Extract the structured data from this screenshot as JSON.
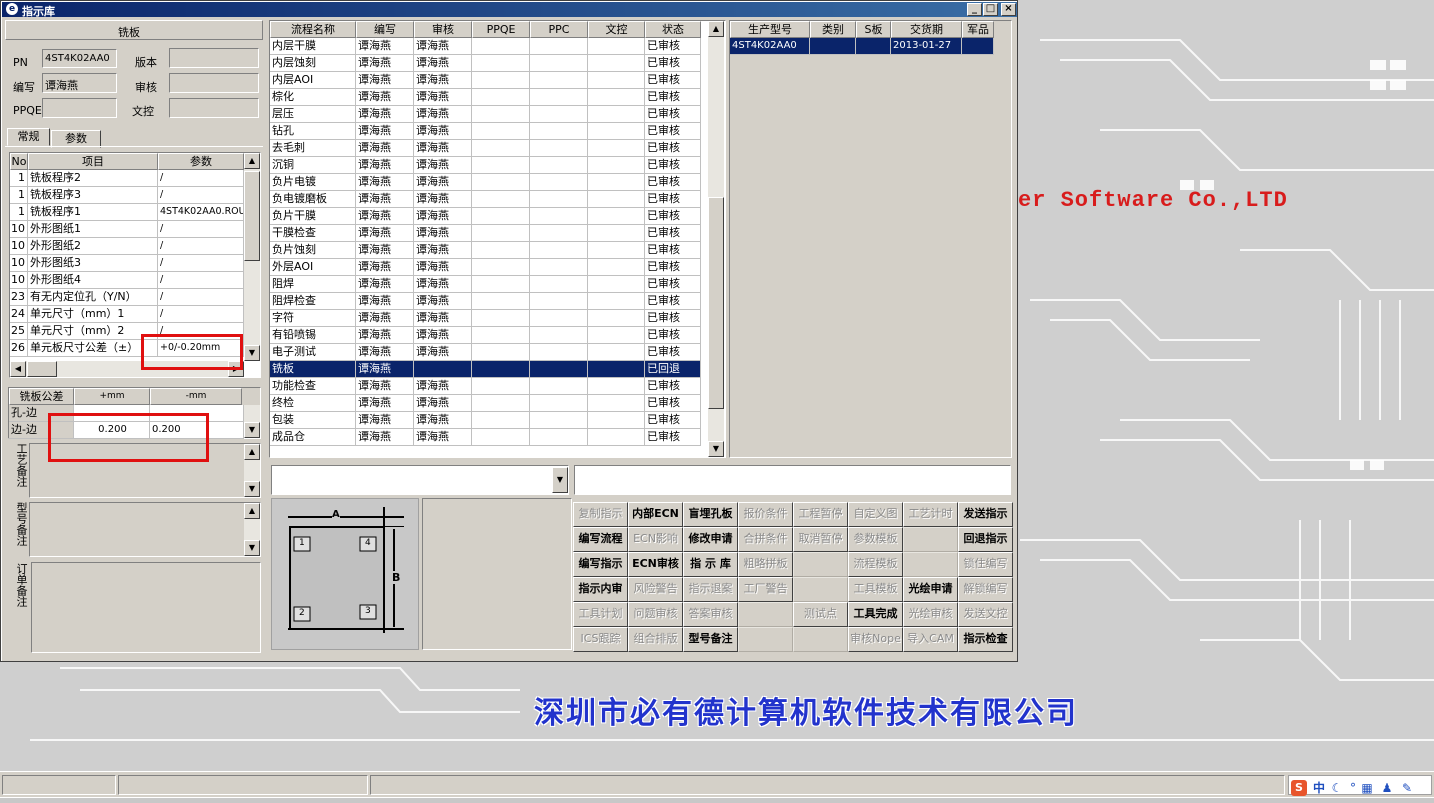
{
  "window": {
    "title": "指示库"
  },
  "left_panel": {
    "section_title": "铣板",
    "fields": {
      "pn_label": "PN",
      "pn_value": "4ST4K02AA0",
      "version_label": "版本",
      "version_value": "",
      "writer_label": "编写",
      "writer_value": "谭海燕",
      "reviewer_label": "审核",
      "reviewer_value": "",
      "ppqe_label": "PPQE",
      "ppqe_value": "",
      "doc_label": "文控",
      "doc_value": ""
    },
    "tabs": [
      "常规",
      "参数"
    ],
    "param_headers": [
      "No",
      "项目",
      "参数"
    ],
    "params": [
      {
        "no": "1",
        "item": "铣板程序2",
        "value": "/"
      },
      {
        "no": "1",
        "item": "铣板程序3",
        "value": "/"
      },
      {
        "no": "1",
        "item": "铣板程序1",
        "value": "4ST4K02AA0.ROU"
      },
      {
        "no": "10",
        "item": "外形图纸1",
        "value": "/"
      },
      {
        "no": "10",
        "item": "外形图纸2",
        "value": "/"
      },
      {
        "no": "10",
        "item": "外形图纸3",
        "value": "/"
      },
      {
        "no": "10",
        "item": "外形图纸4",
        "value": "/"
      },
      {
        "no": "23",
        "item": "有无内定位孔（Y/N）",
        "value": "/"
      },
      {
        "no": "24",
        "item": "单元尺寸（mm）1",
        "value": "/"
      },
      {
        "no": "25",
        "item": "单元尺寸（mm）2",
        "value": "/"
      },
      {
        "no": "26",
        "item": "单元板尺寸公差（±）",
        "value": "+0/-0.20mm"
      }
    ],
    "tolerance_headers": [
      "铣板公差",
      "+mm",
      "-mm"
    ],
    "tolerance_rows": [
      {
        "name": "孔-边",
        "plus": "",
        "minus": ""
      },
      {
        "name": "边-边",
        "plus": "0.200",
        "minus": "0.200"
      }
    ],
    "notes": [
      "工艺备注",
      "型号备注",
      "订单备注"
    ]
  },
  "flow_table": {
    "headers": [
      "流程名称",
      "编写",
      "审核",
      "PPQE",
      "PPC",
      "文控",
      "状态"
    ],
    "rows": [
      {
        "name": "内层干膜",
        "writer": "谭海燕",
        "reviewer": "谭海燕",
        "status": "已审核"
      },
      {
        "name": "内层蚀刻",
        "writer": "谭海燕",
        "reviewer": "谭海燕",
        "status": "已审核"
      },
      {
        "name": "内层AOI",
        "writer": "谭海燕",
        "reviewer": "谭海燕",
        "status": "已审核"
      },
      {
        "name": "棕化",
        "writer": "谭海燕",
        "reviewer": "谭海燕",
        "status": "已审核"
      },
      {
        "name": "层压",
        "writer": "谭海燕",
        "reviewer": "谭海燕",
        "status": "已审核"
      },
      {
        "name": "钻孔",
        "writer": "谭海燕",
        "reviewer": "谭海燕",
        "status": "已审核"
      },
      {
        "name": "去毛刺",
        "writer": "谭海燕",
        "reviewer": "谭海燕",
        "status": "已审核"
      },
      {
        "name": "沉铜",
        "writer": "谭海燕",
        "reviewer": "谭海燕",
        "status": "已审核"
      },
      {
        "name": "负片电镀",
        "writer": "谭海燕",
        "reviewer": "谭海燕",
        "status": "已审核"
      },
      {
        "name": "负电镀磨板",
        "writer": "谭海燕",
        "reviewer": "谭海燕",
        "status": "已审核"
      },
      {
        "name": "负片干膜",
        "writer": "谭海燕",
        "reviewer": "谭海燕",
        "status": "已审核"
      },
      {
        "name": "干膜检查",
        "writer": "谭海燕",
        "reviewer": "谭海燕",
        "status": "已审核"
      },
      {
        "name": "负片蚀刻",
        "writer": "谭海燕",
        "reviewer": "谭海燕",
        "status": "已审核"
      },
      {
        "name": "外层AOI",
        "writer": "谭海燕",
        "reviewer": "谭海燕",
        "status": "已审核"
      },
      {
        "name": "阻焊",
        "writer": "谭海燕",
        "reviewer": "谭海燕",
        "status": "已审核"
      },
      {
        "name": "阻焊检查",
        "writer": "谭海燕",
        "reviewer": "谭海燕",
        "status": "已审核"
      },
      {
        "name": "字符",
        "writer": "谭海燕",
        "reviewer": "谭海燕",
        "status": "已审核"
      },
      {
        "name": "有铅喷锡",
        "writer": "谭海燕",
        "reviewer": "谭海燕",
        "status": "已审核"
      },
      {
        "name": "电子测试",
        "writer": "谭海燕",
        "reviewer": "谭海燕",
        "status": "已审核"
      },
      {
        "name": "铣板",
        "writer": "谭海燕",
        "reviewer": "",
        "status": "已回退"
      },
      {
        "name": "功能检查",
        "writer": "谭海燕",
        "reviewer": "谭海燕",
        "status": "已审核"
      },
      {
        "name": "终检",
        "writer": "谭海燕",
        "reviewer": "谭海燕",
        "status": "已审核"
      },
      {
        "name": "包装",
        "writer": "谭海燕",
        "reviewer": "谭海燕",
        "status": "已审核"
      },
      {
        "name": "成品仓",
        "writer": "谭海燕",
        "reviewer": "谭海燕",
        "status": "已审核"
      }
    ],
    "selected_index": 19
  },
  "product_table": {
    "headers": [
      "生产型号",
      "类别",
      "S板",
      "交货期",
      "军品"
    ],
    "rows": [
      {
        "model": "4ST4K02AA0",
        "type": "",
        "s": "",
        "date": "2013-01-27",
        "mil": ""
      }
    ]
  },
  "diagram": {
    "label_a": "A",
    "label_b": "B",
    "corners": [
      "1",
      "4",
      "2",
      "3"
    ]
  },
  "buttons": [
    {
      "label": "复制指示",
      "state": "dis"
    },
    {
      "label": "内部ECN",
      "state": "en"
    },
    {
      "label": "盲埋孔板",
      "state": "en"
    },
    {
      "label": "报价条件",
      "state": "dis"
    },
    {
      "label": "工程暂停",
      "state": "dis"
    },
    {
      "label": "自定义图",
      "state": "dis"
    },
    {
      "label": "工艺计时",
      "state": "dis"
    },
    {
      "label": "发送指示",
      "state": "en"
    },
    {
      "label": "编写流程",
      "state": "en"
    },
    {
      "label": "ECN影响",
      "state": "dis"
    },
    {
      "label": "修改申请",
      "state": "en"
    },
    {
      "label": "合拼条件",
      "state": "dis"
    },
    {
      "label": "取消暂停",
      "state": "dis"
    },
    {
      "label": "参数模板",
      "state": "dis"
    },
    {
      "label": "",
      "state": "blank"
    },
    {
      "label": "回退指示",
      "state": "en"
    },
    {
      "label": "编写指示",
      "state": "en"
    },
    {
      "label": "ECN审核",
      "state": "en"
    },
    {
      "label": "指 示 库",
      "state": "en"
    },
    {
      "label": "粗略拼板",
      "state": "dis"
    },
    {
      "label": "",
      "state": "blank"
    },
    {
      "label": "流程模板",
      "state": "dis"
    },
    {
      "label": "",
      "state": "blank"
    },
    {
      "label": "锁住编写",
      "state": "dis"
    },
    {
      "label": "指示内审",
      "state": "en"
    },
    {
      "label": "风险警告",
      "state": "dis"
    },
    {
      "label": "指示退案",
      "state": "dis"
    },
    {
      "label": "工厂警告",
      "state": "dis"
    },
    {
      "label": "",
      "state": "blank"
    },
    {
      "label": "工具模板",
      "state": "dis"
    },
    {
      "label": "光绘申请",
      "state": "en"
    },
    {
      "label": "解锁编写",
      "state": "dis"
    },
    {
      "label": "工具计划",
      "state": "dis"
    },
    {
      "label": "问题审核",
      "state": "dis"
    },
    {
      "label": "答案审核",
      "state": "dis"
    },
    {
      "label": "",
      "state": "blank"
    },
    {
      "label": "测试点",
      "state": "dis"
    },
    {
      "label": "工具完成",
      "state": "en"
    },
    {
      "label": "光绘审核",
      "state": "dis"
    },
    {
      "label": "发送文控",
      "state": "dis"
    },
    {
      "label": "ICS跟踪",
      "state": "dis"
    },
    {
      "label": "组合排版",
      "state": "dis"
    },
    {
      "label": "型号备注",
      "state": "en"
    },
    {
      "label": "",
      "state": "blank"
    },
    {
      "label": "",
      "state": "blank"
    },
    {
      "label": "审核Nope",
      "state": "dis"
    },
    {
      "label": "导入CAM",
      "state": "dis"
    },
    {
      "label": "指示检查",
      "state": "en"
    }
  ],
  "desktop": {
    "brand_text": "er Software Co.,LTD",
    "company_text": "深圳市必有德计算机软件技术有限公司"
  },
  "tray": {
    "ime": "中"
  },
  "colors": {
    "title_bar": "#0a246a",
    "selection": "#0a246a",
    "highlight_box": "#e01010",
    "brand_red": "#d81c1c",
    "company_blue": "#2233cc"
  }
}
